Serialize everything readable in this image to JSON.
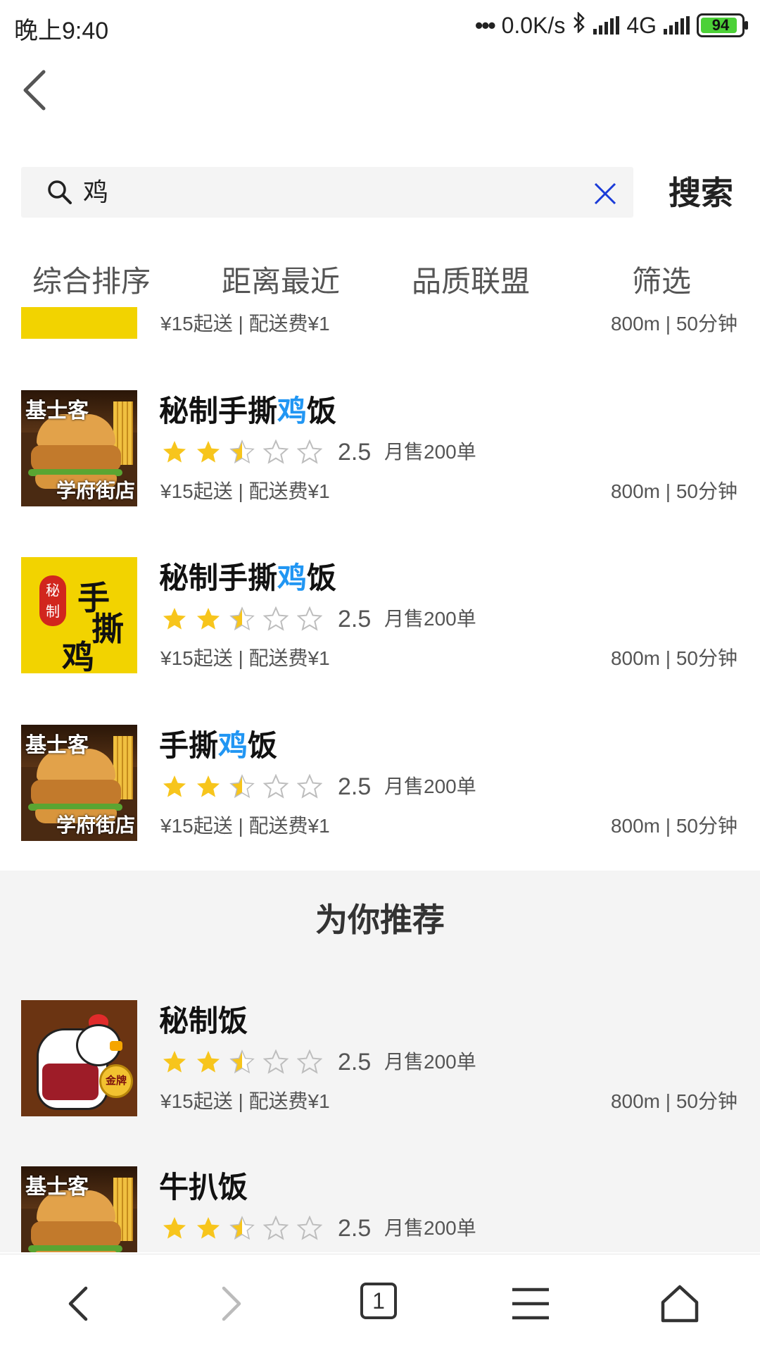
{
  "status_bar": {
    "time": "晚上9:40",
    "network_speed": "0.0K/s",
    "network_type": "4G",
    "battery": "94",
    "battery_level": 0.94
  },
  "search": {
    "query": "鸡",
    "button_label": "搜索"
  },
  "sort_tabs": [
    "综合排序",
    "距离最近",
    "品质联盟",
    "筛选"
  ],
  "partial_top_item": {
    "fee": "¥15起送 | 配送费¥1",
    "distance": "800m | 50分钟"
  },
  "results": [
    {
      "name_before": "秘制手撕",
      "name_highlight": "鸡",
      "name_after": "饭",
      "thumb": "burger",
      "thumb_label_top": "基士客",
      "thumb_label_bottom": "学府街店",
      "rating": "2.5",
      "rating_value": 2.5,
      "sales": "月售200单",
      "fee": "¥15起送 | 配送费¥1",
      "distance": "800m | 50分钟"
    },
    {
      "name_before": "秘制手撕",
      "name_highlight": "鸡",
      "name_after": "饭",
      "thumb": "yellow",
      "thumb_seal": "秘制",
      "thumb_big1": "手",
      "thumb_big2": "撕",
      "thumb_big3": "鸡",
      "rating": "2.5",
      "rating_value": 2.5,
      "sales": "月售200单",
      "fee": "¥15起送 | 配送费¥1",
      "distance": "800m | 50分钟"
    },
    {
      "name_before": "手撕",
      "name_highlight": "鸡",
      "name_after": "饭",
      "thumb": "burger",
      "thumb_label_top": "基士客",
      "thumb_label_bottom": "学府街店",
      "rating": "2.5",
      "rating_value": 2.5,
      "sales": "月售200单",
      "fee": "¥15起送 | 配送费¥1",
      "distance": "800m | 50分钟"
    }
  ],
  "recommend_title": "为你推荐",
  "recommendations": [
    {
      "name": "秘制饭",
      "thumb": "chicken",
      "thumb_medal": "金牌",
      "rating": "2.5",
      "rating_value": 2.5,
      "sales": "月售200单",
      "fee": "¥15起送 | 配送费¥1",
      "distance": "800m | 50分钟"
    },
    {
      "name": "牛扒饭",
      "thumb": "burger",
      "thumb_label_top": "基士客",
      "rating": "2.5",
      "rating_value": 2.5,
      "sales": "月售200单"
    }
  ],
  "bottom_nav": {
    "tab_count": "1",
    "icons": [
      "back-arrow-icon",
      "forward-arrow-icon",
      "tabs-icon",
      "menu-icon",
      "home-icon"
    ]
  },
  "colors": {
    "highlight": "#2196f3",
    "star_filled": "#f7c51c",
    "star_empty": "#bdbdbd",
    "clear_icon": "#1a3bd8",
    "section_gray": "#f4f4f4"
  }
}
